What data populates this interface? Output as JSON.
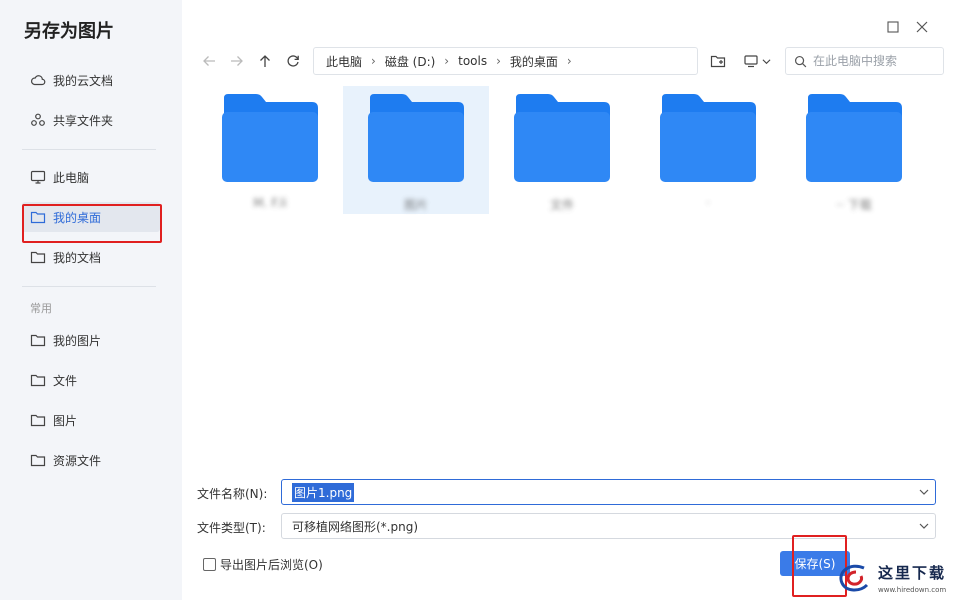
{
  "dialog": {
    "title": "另存为图片"
  },
  "sidebar": {
    "cloud_items": [
      {
        "label": "我的云文档",
        "icon": "cloud-icon"
      },
      {
        "label": "共享文件夹",
        "icon": "share-folder-icon"
      }
    ],
    "local_items": [
      {
        "label": "此电脑",
        "icon": "monitor-icon"
      },
      {
        "label": "我的桌面",
        "icon": "folder-icon",
        "active": true
      },
      {
        "label": "我的文档",
        "icon": "folder-icon"
      }
    ],
    "section_label": "常用",
    "common_items": [
      {
        "label": "我的图片",
        "icon": "folder-icon"
      },
      {
        "label": "文件",
        "icon": "folder-icon"
      },
      {
        "label": "图片",
        "icon": "folder-icon"
      },
      {
        "label": "资源文件",
        "icon": "folder-icon"
      }
    ]
  },
  "toolbar": {
    "breadcrumb": [
      "此电脑",
      "磁盘 (D:)",
      "tools",
      "我的桌面"
    ],
    "search_placeholder": "在此电脑中搜索"
  },
  "folders": [
    {
      "label": "M. F.li"
    },
    {
      "label": "图片",
      "selected": true
    },
    {
      "label": "文件"
    },
    {
      "label": "·"
    },
    {
      "label": "·· 下载"
    }
  ],
  "form": {
    "filename_label": "文件名称(N):",
    "filename_value": "图片1.png",
    "filetype_label": "文件类型(T):",
    "filetype_value": "可移植网络图形(*.png)",
    "open_after_label": "导出图片后浏览(O)",
    "save_label": "保存(S)"
  },
  "watermark": {
    "title": "这里下载",
    "url": "www.hiredown.com"
  },
  "colors": {
    "accent": "#2f6bd8",
    "folder_blue": "#1e7cf0",
    "highlight_red": "#e02020"
  }
}
